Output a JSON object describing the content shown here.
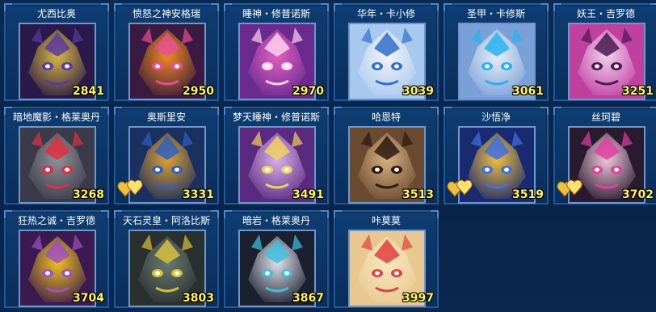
{
  "cards": [
    {
      "name": "尤西比奥",
      "power": "2841",
      "portrait": "dark-dragon",
      "colors": [
        "#2a1a4a",
        "#d8b840",
        "#5a3aa0"
      ],
      "hearts": false
    },
    {
      "name": "愤怒之神安格瑞",
      "power": "2950",
      "portrait": "orange-demon",
      "colors": [
        "#3a1a40",
        "#f08a20",
        "#e85090"
      ],
      "hearts": false
    },
    {
      "name": "睡神・修普诺斯",
      "power": "2970",
      "portrait": "pink-knight",
      "colors": [
        "#6a2a90",
        "#e060c0",
        "#ffd0f0"
      ],
      "hearts": false
    },
    {
      "name": "华年・卡小修",
      "power": "3039",
      "portrait": "white-chibi",
      "colors": [
        "#a8c8f0",
        "#f4f4f8",
        "#3070c8"
      ],
      "hearts": false
    },
    {
      "name": "圣甲・卡修斯",
      "power": "3061",
      "portrait": "white-armor",
      "colors": [
        "#7aa0d8",
        "#e8eef8",
        "#2ab0f0"
      ],
      "hearts": false
    },
    {
      "name": "妖王・吉罗德",
      "power": "3251",
      "portrait": "pink-masked",
      "colors": [
        "#c040a0",
        "#f0d0f0",
        "#4a1a50"
      ],
      "hearts": false
    },
    {
      "name": "暗地魔影・格莱奥丹",
      "power": "3268",
      "portrait": "grey-red",
      "colors": [
        "#3a3a4a",
        "#909098",
        "#e03040"
      ],
      "hearts": false
    },
    {
      "name": "奥斯里安",
      "power": "3331",
      "portrait": "blue-gold",
      "colors": [
        "#1a3060",
        "#e0a030",
        "#3060c0"
      ],
      "hearts": true
    },
    {
      "name": "梦天睡神・修普诺斯",
      "power": "3491",
      "portrait": "purple-knight",
      "colors": [
        "#5a2a80",
        "#d8b0e8",
        "#f0d060"
      ],
      "hearts": false
    },
    {
      "name": "哈恩特",
      "power": "3513",
      "portrait": "brown-beast",
      "colors": [
        "#6a4a30",
        "#d8b080",
        "#2a1a10"
      ],
      "hearts": false
    },
    {
      "name": "沙悟净",
      "power": "3519",
      "portrait": "blue-warrior",
      "colors": [
        "#1a2a70",
        "#f0c040",
        "#4070e0"
      ],
      "hearts": true
    },
    {
      "name": "丝珂碧",
      "power": "3702",
      "portrait": "dark-girl",
      "colors": [
        "#2a1a30",
        "#f0c8d8",
        "#e040a0"
      ],
      "hearts": true
    },
    {
      "name": "狂热之诚・吉罗德",
      "power": "3704",
      "portrait": "purple-gold",
      "colors": [
        "#3a1a50",
        "#f0c020",
        "#a050c0"
      ],
      "hearts": false
    },
    {
      "name": "天石灵皇・阿洛比斯",
      "power": "3803",
      "portrait": "dark-wolf",
      "colors": [
        "#2a3030",
        "#6a7a70",
        "#d8c040"
      ],
      "hearts": false
    },
    {
      "name": "暗岩・格莱奥丹",
      "power": "3867",
      "portrait": "dark-cyan",
      "colors": [
        "#1a2030",
        "#e0e0e8",
        "#40c0e0"
      ],
      "hearts": false
    },
    {
      "name": "咔莫莫",
      "power": "3997",
      "portrait": "cream-blob",
      "colors": [
        "#e8c890",
        "#f8e8c0",
        "#e04040"
      ],
      "hearts": false
    }
  ]
}
